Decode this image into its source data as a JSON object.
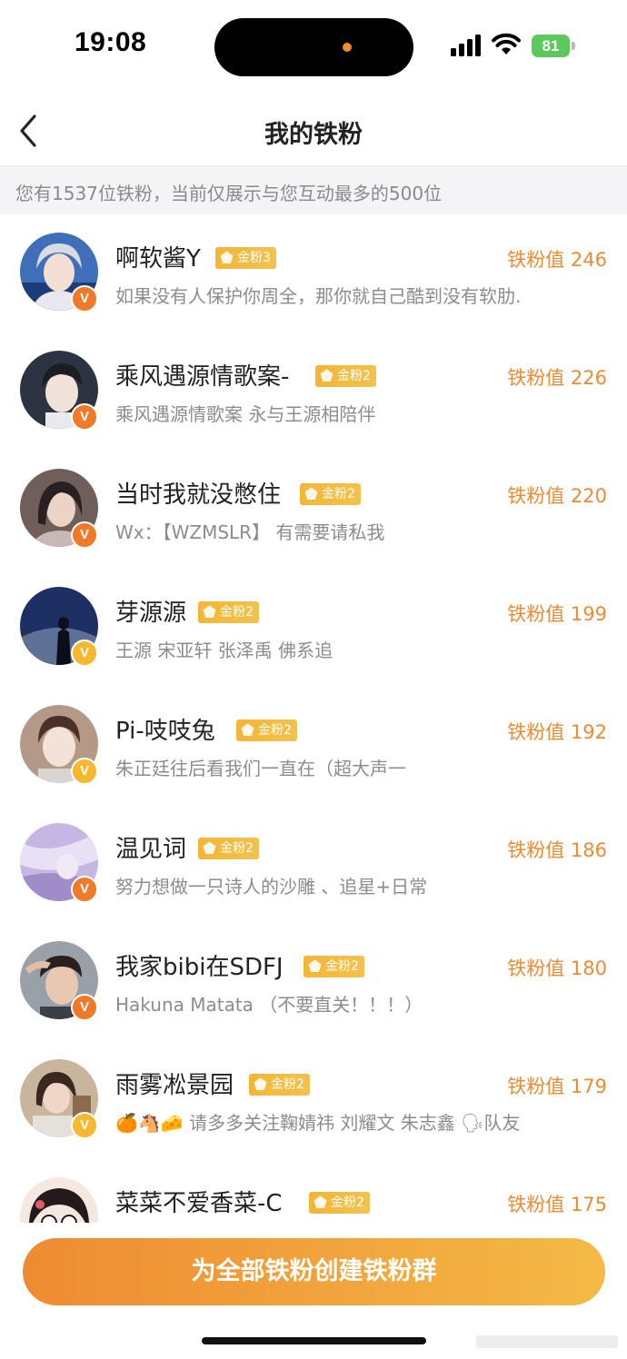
{
  "status_bar": {
    "time": "19:08",
    "battery": "81"
  },
  "nav": {
    "title": "我的铁粉",
    "back_icon": "chevron-left-icon"
  },
  "notice": "您有1537位铁粉，当前仅展示与您互动最多的500位",
  "score_label": "铁粉值",
  "fans": [
    {
      "name": "啊软酱Y",
      "medal": "金粉3",
      "score": "246",
      "bio": "如果没有人保护你周全，那你就自己酷到没有软肋."
    },
    {
      "name": "乘风遇源情歌案-",
      "medal": "金粉2",
      "score": "226",
      "bio": "乘风遇源情歌案 永与王源相陪伴"
    },
    {
      "name": "当时我就没憋住",
      "medal": "金粉2",
      "score": "220",
      "bio": "Wx：【WZMSLR】 有需要请私我"
    },
    {
      "name": "芽源源",
      "medal": "金粉2",
      "score": "199",
      "bio": "王源 宋亚轩 张泽禹 佛系追"
    },
    {
      "name": "Pi-吱吱兔",
      "medal": "金粉2",
      "score": "192",
      "bio": "朱正廷往后看我们一直在（超大声一"
    },
    {
      "name": "温见词",
      "medal": "金粉2",
      "score": "186",
      "bio": "努力想做一只诗人的沙雕 、追星+日常"
    },
    {
      "name": "我家bibi在SDFJ",
      "medal": "金粉2",
      "score": "180",
      "bio": "Hakuna Matata （不要直关！！！）"
    },
    {
      "name": "雨雾凇景园",
      "medal": "金粉2",
      "score": "179",
      "bio": "🍊🐴🧀 请多多关注鞠婧祎 刘耀文 朱志鑫 🗣队友"
    },
    {
      "name": "菜菜不爱香菜-C",
      "medal": "金粉2",
      "score": "175",
      "bio": ""
    }
  ],
  "cta": {
    "label": "为全部铁粉创建铁粉群"
  },
  "colors": {
    "accent": "#ee8a32",
    "medal": "#f3b636",
    "badge_orange": "#ef7a2a",
    "badge_yellow": "#f5b82e"
  }
}
